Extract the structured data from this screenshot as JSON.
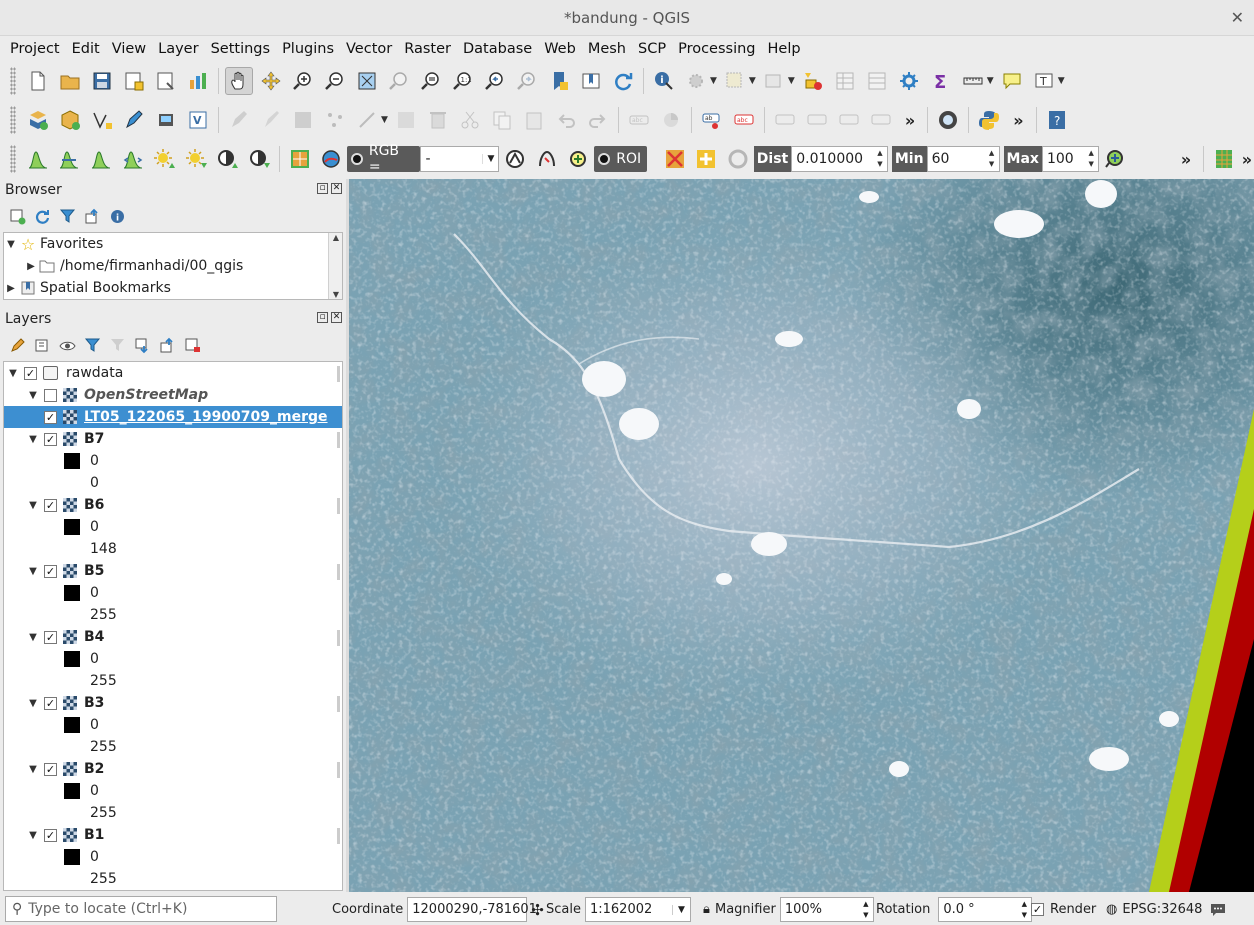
{
  "window": {
    "title": "*bandung - QGIS",
    "close_glyph": "✕"
  },
  "menu": [
    "Project",
    "Edit",
    "View",
    "Layer",
    "Settings",
    "Plugins",
    "Vector",
    "Raster",
    "Database",
    "Web",
    "Mesh",
    "SCP",
    "Processing",
    "Help"
  ],
  "toolbar_more": "»",
  "scp": {
    "rgb_label": "RGB =",
    "rgb_value": "-",
    "roi_label": "ROI",
    "dist_label": "Dist",
    "dist_value": "0.010000",
    "min_label": "Min",
    "min_value": "60",
    "max_label": "Max",
    "max_value": "100"
  },
  "browser": {
    "title": "Browser",
    "items": [
      {
        "label": "Favorites",
        "icon": "star-icon",
        "expanded": true
      },
      {
        "label": "/home/firmanhadi/00_qgis",
        "icon": "folder-icon",
        "expanded": false
      },
      {
        "label": "Spatial Bookmarks",
        "icon": "bookmark-icon",
        "expanded": false
      }
    ]
  },
  "layers": {
    "title": "Layers",
    "group": {
      "label": "rawdata",
      "checked": true
    },
    "osm": {
      "label": "OpenStreetMap",
      "checked": false
    },
    "merge": {
      "label": "LT05_122065_19900709_merge",
      "checked": true,
      "selected": true
    },
    "bands": [
      {
        "name": "B7",
        "min": "0",
        "max": "0"
      },
      {
        "name": "B6",
        "min": "0",
        "max": "148"
      },
      {
        "name": "B5",
        "min": "0",
        "max": "255"
      },
      {
        "name": "B4",
        "min": "0",
        "max": "255"
      },
      {
        "name": "B3",
        "min": "0",
        "max": "255"
      },
      {
        "name": "B2",
        "min": "0",
        "max": "255"
      },
      {
        "name": "B1",
        "min": "0",
        "max": "255"
      }
    ]
  },
  "status": {
    "locate_placeholder": "Type to locate (Ctrl+K)",
    "coordinate_label": "Coordinate",
    "coordinate_value": "12000290,-781601",
    "scale_label": "Scale",
    "scale_value": "1:162002",
    "magnifier_label": "Magnifier",
    "magnifier_value": "100%",
    "rotation_label": "Rotation",
    "rotation_value": "0.0 °",
    "render_label": "Render",
    "render_checked": true,
    "crs": "EPSG:32648"
  },
  "colors": {
    "selection": "#3d8fd1",
    "map_base": "#6d97aa",
    "strip_yellow": "#b5cf1a",
    "strip_red": "#b10000"
  }
}
